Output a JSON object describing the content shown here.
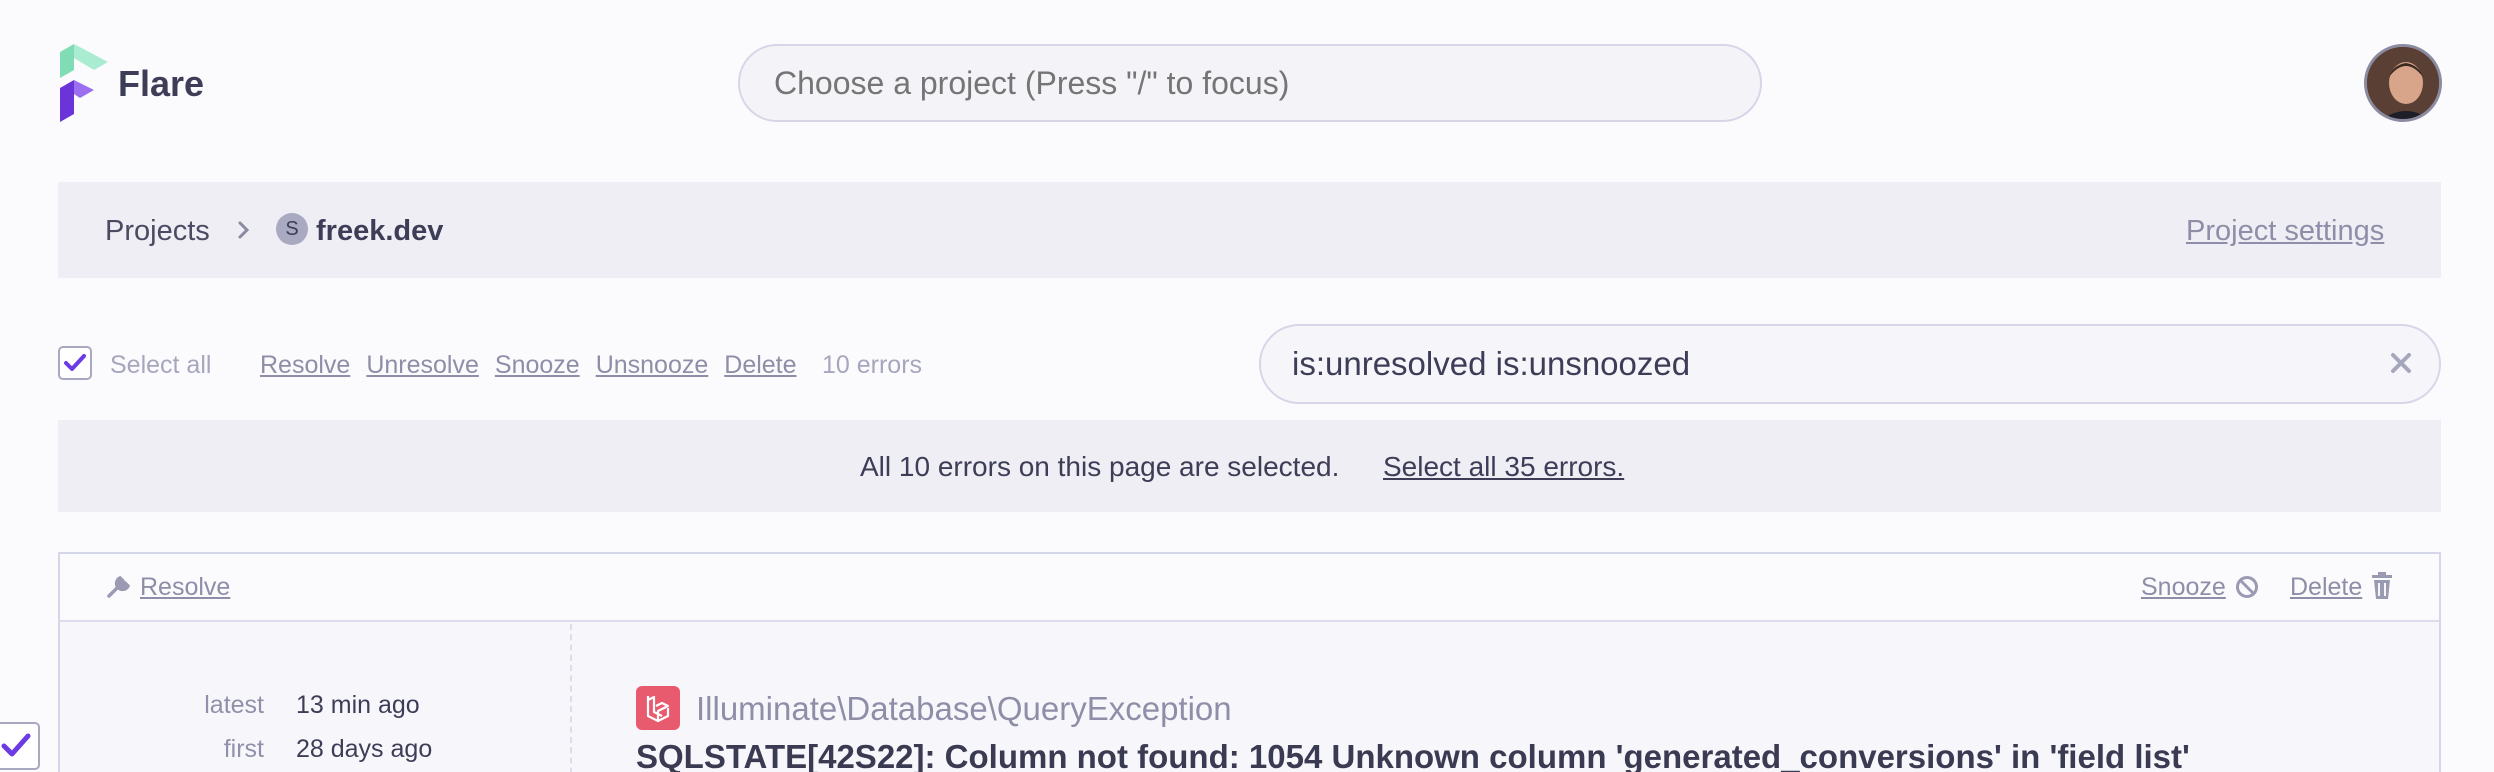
{
  "app": {
    "name": "Flare"
  },
  "search": {
    "placeholder": "Choose a project (Press \"/\" to focus)"
  },
  "breadcrumb": {
    "root": "Projects",
    "project_initial": "S",
    "project": "freek.dev",
    "settings_link": "Project settings"
  },
  "toolbar": {
    "select_all": "Select all",
    "actions": [
      "Resolve",
      "Unresolve",
      "Snooze",
      "Unsnooze",
      "Delete"
    ],
    "count": "10 errors",
    "filter_value": "is:unresolved is:unsnoozed"
  },
  "banner": {
    "text": "All 10 errors on this page are selected.",
    "link": "Select all 35 errors."
  },
  "error_card": {
    "resolve": "Resolve",
    "snooze": "Snooze",
    "delete": "Delete",
    "latest_label": "latest",
    "latest_value": "13 min ago",
    "first_label": "first",
    "first_value": "28 days ago",
    "exception_class": "Illuminate\\Database\\QueryException",
    "message": "SQLSTATE[42S22]: Column not found: 1054 Unknown column 'generated_conversions' in 'field list'"
  },
  "colors": {
    "accent": "#6c3be3",
    "laravel": "#e85b6f",
    "logo_green": "#9ee6c6",
    "logo_purple": "#7b48e6"
  }
}
